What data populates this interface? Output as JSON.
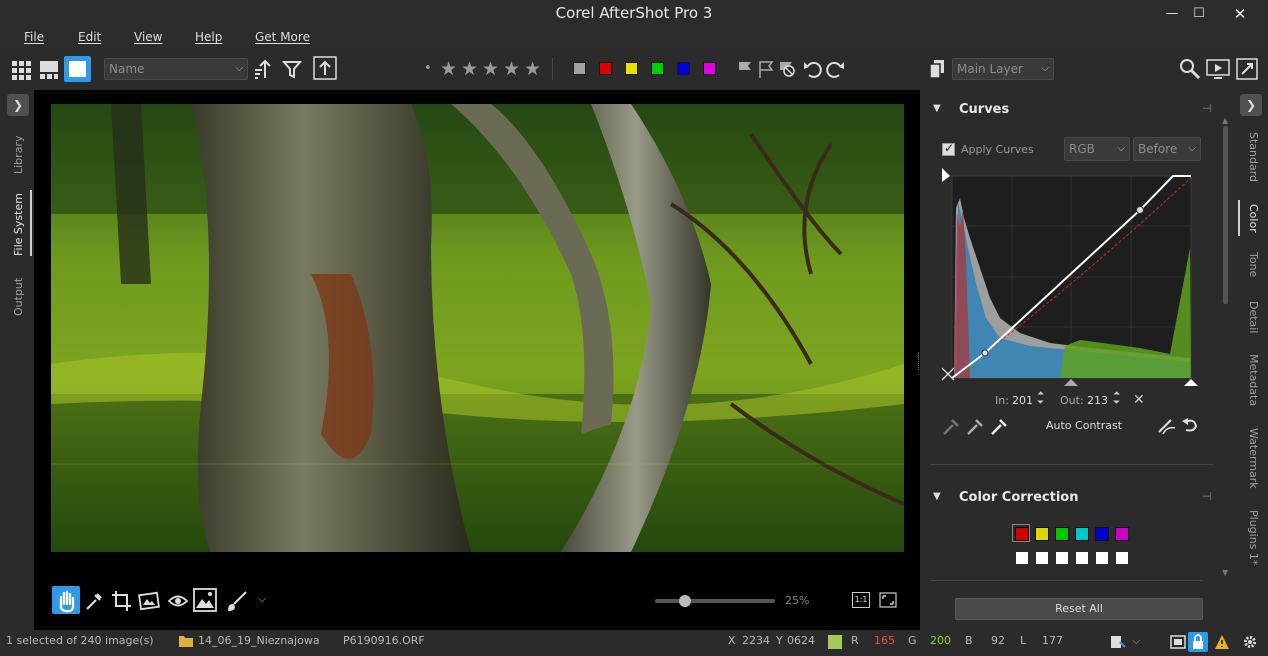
{
  "app": {
    "title": "Corel AfterShot Pro 3"
  },
  "window_controls": {
    "minimize": "—",
    "maximize": "☐",
    "close": "✕"
  },
  "menu": [
    "File",
    "Edit",
    "View",
    "Help",
    "Get More"
  ],
  "toolbar": {
    "sort_field": "Name",
    "rating_dot": "•",
    "stars": [
      "★",
      "★",
      "★",
      "★",
      "★"
    ],
    "color_labels": [
      "#a0a0a0",
      "#e00000",
      "#e8e000",
      "#00d000",
      "#0000e0",
      "#e000e0"
    ],
    "layer_select": "Main Layer"
  },
  "left_tabs": [
    "Library",
    "File System",
    "Output"
  ],
  "left_tabs_active": "File System",
  "right_tabs": [
    "Standard",
    "Color",
    "Tone",
    "Detail",
    "Metadata",
    "Watermark",
    "Plugins 1*"
  ],
  "right_tabs_active": "Color",
  "curves": {
    "title": "Curves",
    "apply_label": "Apply Curves",
    "apply_checked": true,
    "channel": "RGB",
    "compare": "Before",
    "in_label": "In:",
    "in_value": "201",
    "out_label": "Out:",
    "out_value": "213",
    "auto_contrast": "Auto Contrast"
  },
  "color_correction": {
    "title": "Color Correction",
    "swatches": [
      "#d00000",
      "#d8d800",
      "#00c800",
      "#00c8c8",
      "#0000c8",
      "#c800c8"
    ]
  },
  "reset_all": "Reset All",
  "viewer": {
    "zoom_value": 25,
    "zoom_label": "25%",
    "one_to_one": "1:1"
  },
  "status": {
    "selection": "1 selected of 240 image(s)",
    "folder": "14_06_19_Nieznajowa",
    "file": "P6190916.ORF",
    "x_label": "X",
    "x": "2234",
    "y_label": "Y",
    "y": "0624",
    "r_label": "R",
    "r": "165",
    "g_label": "G",
    "g": "200",
    "b_label": "B",
    "b": "92",
    "l_label": "L",
    "l": "177",
    "pixel_color": "#a5c85c"
  }
}
